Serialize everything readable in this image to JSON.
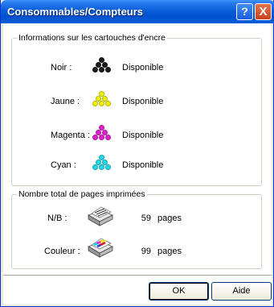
{
  "window": {
    "title": "Consommables/Compteurs",
    "help_button": "?",
    "close_button": "X"
  },
  "ink_group": {
    "legend": "Informations sur les cartouches d'encre",
    "rows": [
      {
        "label": "Noir :",
        "status": "Disponible",
        "color": "#1a1a1a",
        "icon": "ink-drops-black-icon"
      },
      {
        "label": "Jaune :",
        "status": "Disponible",
        "color": "#f2f200",
        "icon": "ink-drops-yellow-icon"
      },
      {
        "label": "Magenta :",
        "status": "Disponible",
        "color": "#e020d0",
        "icon": "ink-drops-magenta-icon"
      },
      {
        "label": "Cyan :",
        "status": "Disponible",
        "color": "#20d8e8",
        "icon": "ink-drops-cyan-icon"
      }
    ]
  },
  "pages_group": {
    "legend": "Nombre total de pages imprimées",
    "rows": [
      {
        "label": "N/B :",
        "count": "59",
        "unit": "pages",
        "icon": "bw-paper-stack-icon"
      },
      {
        "label": "Couleur :",
        "count": "99",
        "unit": "pages",
        "icon": "color-paper-stack-icon"
      }
    ]
  },
  "buttons": {
    "ok": "OK",
    "help": "Aide"
  }
}
